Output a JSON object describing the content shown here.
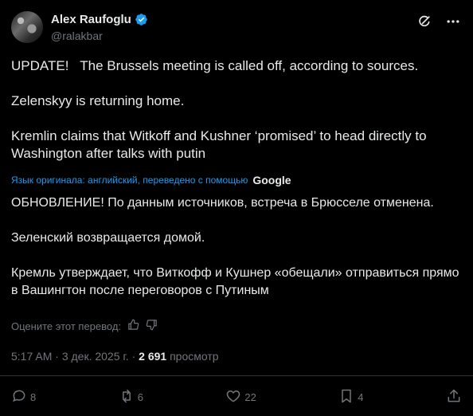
{
  "author": {
    "name": "Alex Raufoglu",
    "handle": "@ralakbar",
    "verified": true
  },
  "tweet": {
    "text_en": "UPDATE!   The Brussels meeting is called off, according to sources.\n\nZelenskyy is returning home.\n\nKremlin claims that Witkoff and Kushner ‘promised’ to head directly to Washington after talks with putin",
    "translation_note": "Язык оригинала: английский, переведено с помощью",
    "translation_provider": "Google",
    "text_ru": "ОБНОВЛЕНИЕ! По данным источников, встреча в Брюсселе отменена.\n\nЗеленский возвращается домой.\n\nКремль утверждает, что Виткофф и Кушнер «обещали» отправиться прямо в Вашингтон после переговоров с Путиным",
    "rate_translation": "Оцените этот перевод:",
    "time": "5:17 AM",
    "date": "3 дек. 2025 г.",
    "views_count": "2 691",
    "views_label": "просмотр"
  },
  "actions": {
    "replies": "8",
    "reposts": "6",
    "likes": "22",
    "bookmarks": "4"
  },
  "colors": {
    "background": "#000000",
    "text": "#e7e9ea",
    "muted": "#71767b",
    "accent": "#1d9bf0",
    "divider": "#2f3336"
  }
}
